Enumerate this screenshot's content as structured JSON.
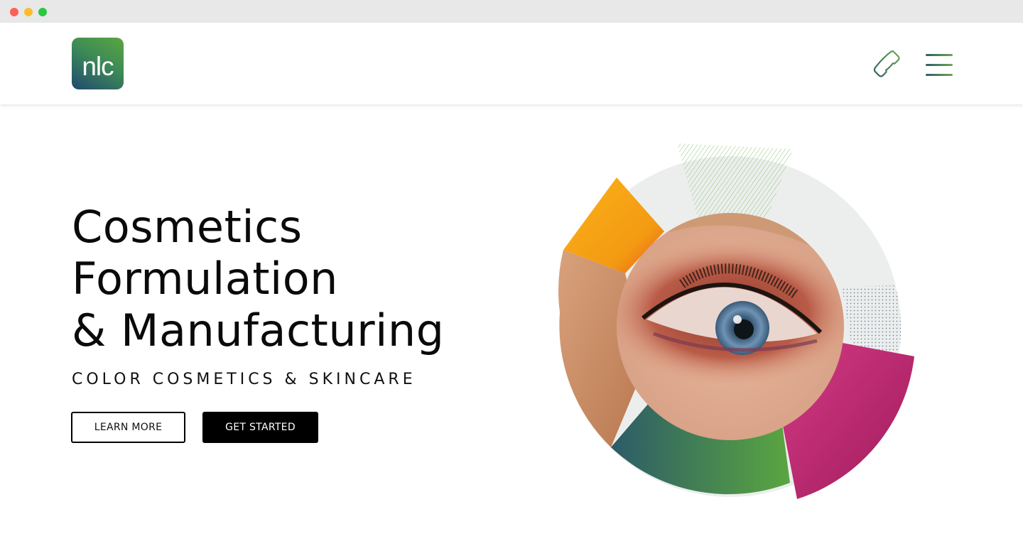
{
  "window": {
    "controls": [
      "close",
      "minimize",
      "maximize"
    ]
  },
  "header": {
    "logo_text": "nlc",
    "phone_icon": "phone-icon",
    "menu_icon": "hamburger-menu-icon"
  },
  "hero": {
    "title_lines": [
      "Cosmetics",
      "Formulation",
      "& Manufacturing"
    ],
    "subtitle": "COLOR COSMETICS & SKINCARE",
    "learn_more_label": "LEARN MORE",
    "get_started_label": "GET STARTED"
  },
  "graphic": {
    "description_icon": "eye-makeup-collage",
    "colors": {
      "ring": "#eceeed",
      "orange": "#f7a11a",
      "skin": "#c98a64",
      "green_start": "#2c5b68",
      "green_end": "#5aa640",
      "magenta": "#c3246f",
      "hatch": "#8fc57a",
      "dots": "#7a8aa0"
    }
  },
  "colors": {
    "brand_green": "#5aa640",
    "brand_navy": "#214a6e",
    "text": "#0a0a0a"
  }
}
